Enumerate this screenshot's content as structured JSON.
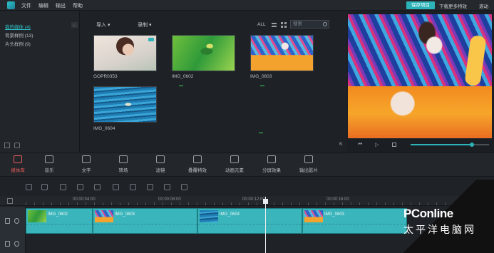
{
  "menu": [
    "文件",
    "编辑",
    "输出",
    "帮助"
  ],
  "title_actions": {
    "save": "保存项目",
    "download": "下载更多特效",
    "scroll": "滚动"
  },
  "library": {
    "items": [
      {
        "label": "我的媒体 (4)"
      },
      {
        "label": "背景样例 (13)"
      },
      {
        "label": "片头样例 (9)"
      }
    ],
    "collapse_icon": "←"
  },
  "media": {
    "import_label": "导入 ▾",
    "record_label": "录制 ▾",
    "filter_all": "ALL",
    "search_placeholder": "搜索",
    "items": [
      {
        "name": "GOPR0353"
      },
      {
        "name": "IMG_0602"
      },
      {
        "name": "IMG_0603"
      },
      {
        "name": "IMG_0604"
      }
    ]
  },
  "preview": {
    "controls": [
      "K",
      "⏮",
      "▷"
    ],
    "progress_fraction": 0.78
  },
  "tools": [
    {
      "label": "媒体库",
      "icon": "folder-icon",
      "active": true
    },
    {
      "label": "音乐",
      "icon": "music-note-icon"
    },
    {
      "label": "文字",
      "icon": "text-icon"
    },
    {
      "label": "转场",
      "icon": "transition-icon"
    },
    {
      "label": "滤镜",
      "icon": "filter-icon"
    },
    {
      "label": "叠覆特效",
      "icon": "overlay-icon"
    },
    {
      "label": "动画元素",
      "icon": "image-icon"
    },
    {
      "label": "分屏效果",
      "icon": "split-screen-icon"
    },
    {
      "label": "输出影片",
      "icon": "export-icon"
    }
  ],
  "ruler": {
    "ticks": [
      "00:00:04:00",
      "00:00:08:00",
      "00:00:12:00",
      "00:00:16:00"
    ]
  },
  "timeline": {
    "clips": [
      {
        "label": "IMG_0602"
      },
      {
        "label": "IMG_0603"
      },
      {
        "label": "IMG_0604"
      },
      {
        "label": "IMG_0603"
      }
    ]
  },
  "watermark": {
    "text": "PConline",
    "sub": "太平洋电脑网"
  },
  "colors": {
    "accent": "#2bb3b8",
    "active_tab": "#e65a5a",
    "clip": "#3ab5bb"
  }
}
